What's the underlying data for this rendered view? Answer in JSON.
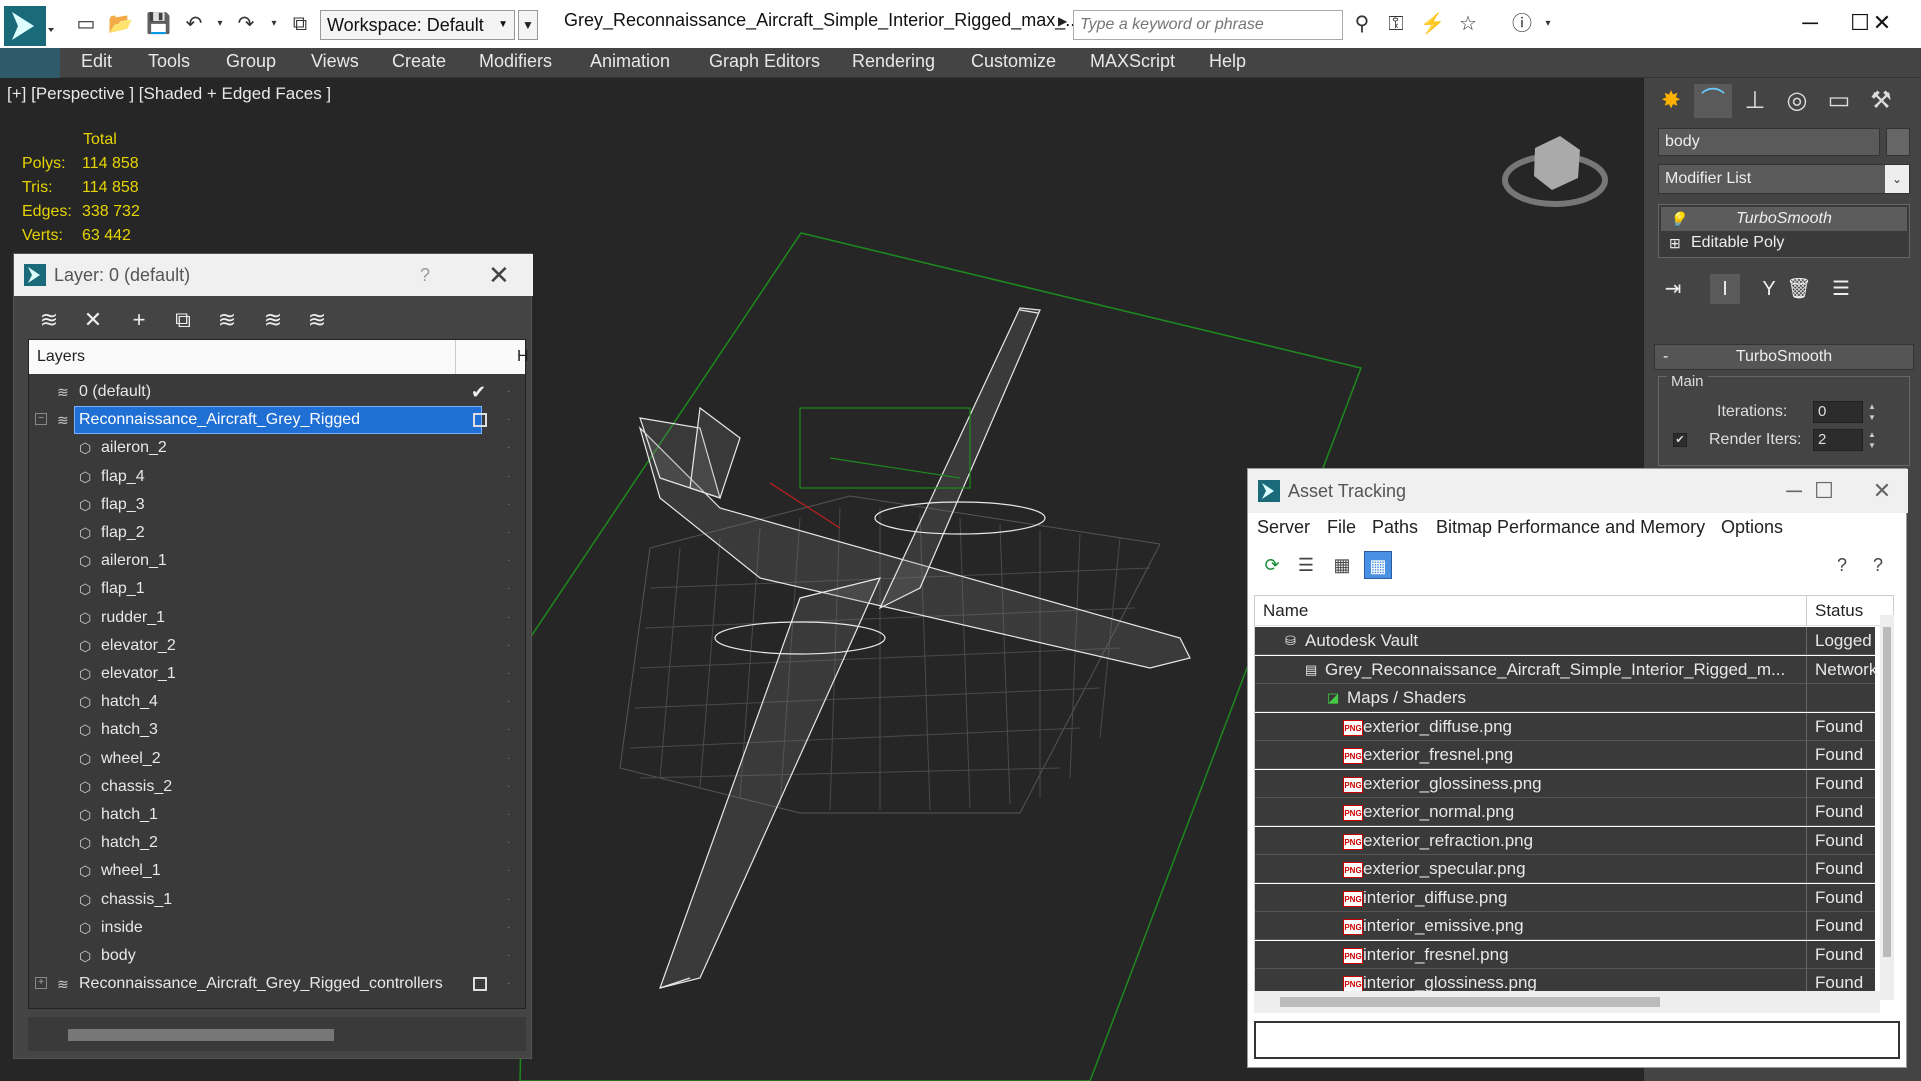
{
  "topbar": {
    "workspace_label": "Workspace: Default",
    "file_title": "Grey_Reconnaissance_Aircraft_Simple_Interior_Rigged_max_...",
    "search_placeholder": "Type a keyword or phrase"
  },
  "menu": [
    "Edit",
    "Tools",
    "Group",
    "Views",
    "Create",
    "Modifiers",
    "Animation",
    "Graph Editors",
    "Rendering",
    "Customize",
    "MAXScript",
    "Help"
  ],
  "viewport": {
    "label": "[+] [Perspective ] [Shaded + Edged Faces ]",
    "stats_header": "Total",
    "stats": [
      {
        "k": "Polys:",
        "v": "114 858"
      },
      {
        "k": "Tris:",
        "v": "114 858"
      },
      {
        "k": "Edges:",
        "v": "338 732"
      },
      {
        "k": "Verts:",
        "v": "63 442"
      }
    ]
  },
  "command_panel": {
    "object_name": "body",
    "modifier_list": "Modifier List",
    "stack": [
      "TurboSmooth",
      "Editable Poly"
    ],
    "rollout_title": "TurboSmooth",
    "group_label": "Main",
    "iterations_label": "Iterations:",
    "iterations_value": "0",
    "render_iters_label": "Render Iters:",
    "render_iters_value": "2"
  },
  "layer_window": {
    "title": "Layer: 0 (default)",
    "help": "?",
    "col_layers": "Layers",
    "col_h": "H",
    "rows": [
      {
        "name": "0 (default)",
        "level": 0,
        "type": "layer",
        "check": true
      },
      {
        "name": "Reconnaissance_Aircraft_Grey_Rigged",
        "level": 0,
        "type": "layer",
        "selected": true,
        "expand": "−",
        "box": true
      },
      {
        "name": "aileron_2",
        "level": 1,
        "type": "object"
      },
      {
        "name": "flap_4",
        "level": 1,
        "type": "object"
      },
      {
        "name": "flap_3",
        "level": 1,
        "type": "object"
      },
      {
        "name": "flap_2",
        "level": 1,
        "type": "object"
      },
      {
        "name": "aileron_1",
        "level": 1,
        "type": "object"
      },
      {
        "name": "flap_1",
        "level": 1,
        "type": "object"
      },
      {
        "name": "rudder_1",
        "level": 1,
        "type": "object"
      },
      {
        "name": "elevator_2",
        "level": 1,
        "type": "object"
      },
      {
        "name": "elevator_1",
        "level": 1,
        "type": "object"
      },
      {
        "name": "hatch_4",
        "level": 1,
        "type": "object"
      },
      {
        "name": "hatch_3",
        "level": 1,
        "type": "object"
      },
      {
        "name": "wheel_2",
        "level": 1,
        "type": "object"
      },
      {
        "name": "chassis_2",
        "level": 1,
        "type": "object"
      },
      {
        "name": "hatch_1",
        "level": 1,
        "type": "object"
      },
      {
        "name": "hatch_2",
        "level": 1,
        "type": "object"
      },
      {
        "name": "wheel_1",
        "level": 1,
        "type": "object"
      },
      {
        "name": "chassis_1",
        "level": 1,
        "type": "object"
      },
      {
        "name": "inside",
        "level": 1,
        "type": "object"
      },
      {
        "name": "body",
        "level": 1,
        "type": "object"
      },
      {
        "name": "Reconnaissance_Aircraft_Grey_Rigged_controllers",
        "level": 0,
        "type": "layer",
        "expand": "+",
        "box": true
      }
    ]
  },
  "asset_window": {
    "title": "Asset Tracking",
    "menu": [
      "Server",
      "File",
      "Paths",
      "Bitmap Performance and Memory",
      "Options"
    ],
    "col_name": "Name",
    "col_status": "Status",
    "rows": [
      {
        "name": "Autodesk Vault",
        "status": "Logged",
        "level": 0,
        "icon": "vault"
      },
      {
        "name": "Grey_Reconnaissance_Aircraft_Simple_Interior_Rigged_m...",
        "status": "Network",
        "level": 1,
        "icon": "max"
      },
      {
        "name": "Maps / Shaders",
        "status": "",
        "level": 2,
        "icon": "maps"
      },
      {
        "name": "exterior_diffuse.png",
        "status": "Found",
        "level": 3,
        "icon": "png"
      },
      {
        "name": "exterior_fresnel.png",
        "status": "Found",
        "level": 3,
        "icon": "png"
      },
      {
        "name": "exterior_glossiness.png",
        "status": "Found",
        "level": 3,
        "icon": "png"
      },
      {
        "name": "exterior_normal.png",
        "status": "Found",
        "level": 3,
        "icon": "png"
      },
      {
        "name": "exterior_refraction.png",
        "status": "Found",
        "level": 3,
        "icon": "png"
      },
      {
        "name": "exterior_specular.png",
        "status": "Found",
        "level": 3,
        "icon": "png"
      },
      {
        "name": "interior_diffuse.png",
        "status": "Found",
        "level": 3,
        "icon": "png"
      },
      {
        "name": "interior_emissive.png",
        "status": "Found",
        "level": 3,
        "icon": "png"
      },
      {
        "name": "interior_fresnel.png",
        "status": "Found",
        "level": 3,
        "icon": "png"
      },
      {
        "name": "interior_glossiness.png",
        "status": "Found",
        "level": 3,
        "icon": "png"
      }
    ]
  },
  "colors": {
    "selection": "#1f6fd4",
    "stats": "#e6d400",
    "grid_green": "#1e8a1e"
  }
}
